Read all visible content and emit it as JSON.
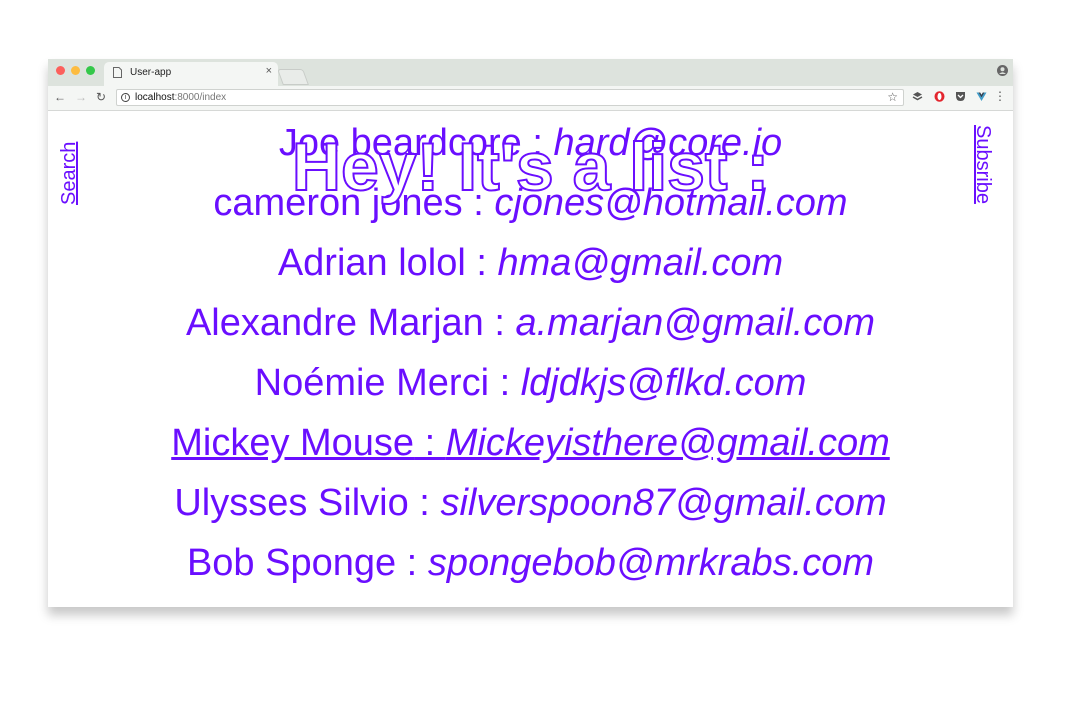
{
  "browser": {
    "tab_title": "User-app",
    "tab_close": "×",
    "url_host": "localhost",
    "url_path": ":8000/index",
    "nav": {
      "back": "←",
      "forward": "→",
      "reload": "↻"
    },
    "icons": [
      "document-icon",
      "close-icon",
      "profile-icon",
      "info-icon",
      "star-icon",
      "pocket-icon",
      "opera-icon",
      "shield-icon",
      "vue-icon",
      "menu-icon"
    ]
  },
  "page": {
    "title": "Hey! It's a list :",
    "search_link": "Search",
    "subscribe_link": "Subsribe",
    "users": [
      {
        "name": "Joe beardcore",
        "sep": " : ",
        "email": "hard@core.io"
      },
      {
        "name": "cameron jones",
        "sep": " : ",
        "email": "cjones@hotmail.com"
      },
      {
        "name": "Adrian lolol",
        "sep": " : ",
        "email": "hma@gmail.com"
      },
      {
        "name": "Alexandre Marjan",
        "sep": " : ",
        "email": "a.marjan@gmail.com"
      },
      {
        "name": "Noémie Merci",
        "sep": " : ",
        "email": "ldjdkjs@flkd.com"
      },
      {
        "name": "Mickey Mouse",
        "sep": " : ",
        "email": "Mickeyisthere@gmail.com"
      },
      {
        "name": "Ulysses Silvio",
        "sep": " : ",
        "email": "silverspoon87@gmail.com"
      },
      {
        "name": "Bob Sponge",
        "sep": " : ",
        "email": "spongebob@mrkrabs.com"
      }
    ]
  },
  "colors": {
    "accent": "#6a0eff",
    "chrome": "#dde3dd",
    "toolbar": "#f4f6f4"
  }
}
